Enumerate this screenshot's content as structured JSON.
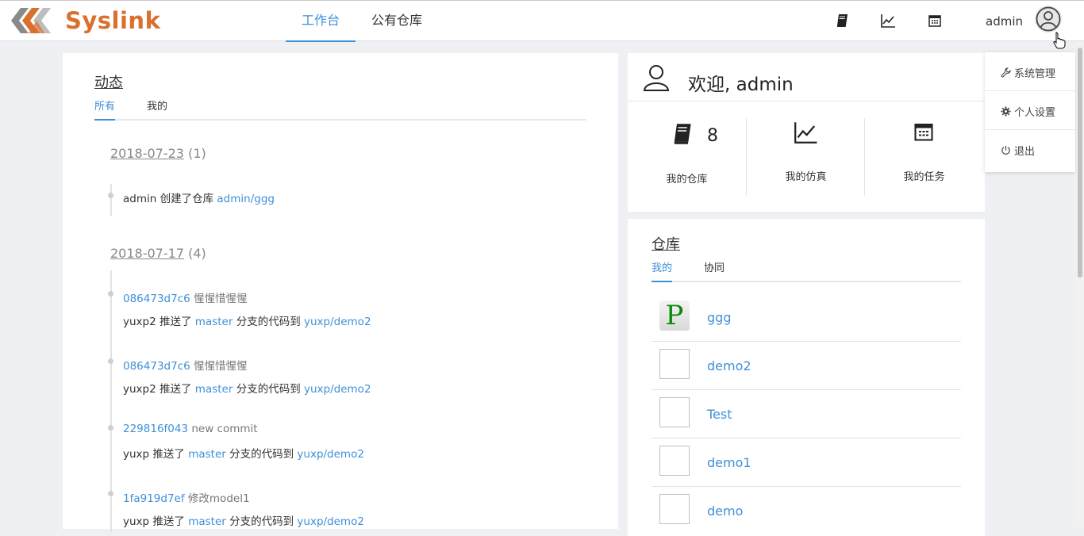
{
  "brand": {
    "name": "Syslink",
    "color": "#d9702e"
  },
  "nav": {
    "items": [
      {
        "label": "工作台",
        "active": true
      },
      {
        "label": "公有仓库",
        "active": false
      }
    ]
  },
  "header": {
    "icons": [
      "book-icon",
      "line-chart-icon",
      "calendar-icon"
    ],
    "username": "admin"
  },
  "user_menu": {
    "items": [
      {
        "label": "系统管理",
        "icon": "wrench-icon"
      },
      {
        "label": "个人设置",
        "icon": "gear-icon"
      },
      {
        "label": "退出",
        "icon": "power-icon"
      }
    ]
  },
  "activity": {
    "title": "动态",
    "tabs": [
      "所有",
      "我的"
    ],
    "groups": [
      {
        "date": "2018-07-23",
        "count": "(1)",
        "entries": [
          {
            "actor": "admin",
            "action": "创建了仓库",
            "repo": "admin/ggg"
          }
        ]
      },
      {
        "date": "2018-07-17",
        "count": "(4)",
        "entries": [
          {
            "commit": "086473d7c6",
            "message": "惺惺惜惺惺",
            "actor": "yuxp2",
            "action": "推送了",
            "branch": "master",
            "mid": "分支的代码到",
            "repo": "yuxp/demo2"
          },
          {
            "commit": "086473d7c6",
            "message": "惺惺惜惺惺",
            "actor": "yuxp2",
            "action": "推送了",
            "branch": "master",
            "mid": "分支的代码到",
            "repo": "yuxp/demo2"
          },
          {
            "commit": "229816f043",
            "message": "new commit",
            "actor": "yuxp",
            "action": "推送了",
            "branch": "master",
            "mid": "分支的代码到",
            "repo": "yuxp/demo2"
          },
          {
            "commit": "1fa919d7ef",
            "message": "修改model1",
            "actor": "yuxp",
            "action": "推送了",
            "branch": "master",
            "mid": "分支的代码到",
            "repo": "yuxp/demo2"
          }
        ]
      }
    ]
  },
  "welcome": {
    "title": "欢迎, admin",
    "stats": [
      {
        "label": "我的仓库",
        "value": "8",
        "icon": "book-icon"
      },
      {
        "label": "我的仿真",
        "value": "",
        "icon": "line-chart-icon"
      },
      {
        "label": "我的任务",
        "value": "",
        "icon": "calendar-icon"
      }
    ]
  },
  "repos": {
    "title": "仓库",
    "tabs": [
      "我的",
      "协同"
    ],
    "items": [
      {
        "name": "ggg",
        "thumb": "P"
      },
      {
        "name": "demo2",
        "thumb": ""
      },
      {
        "name": "Test",
        "thumb": ""
      },
      {
        "name": "demo1",
        "thumb": ""
      },
      {
        "name": "demo",
        "thumb": ""
      }
    ]
  }
}
